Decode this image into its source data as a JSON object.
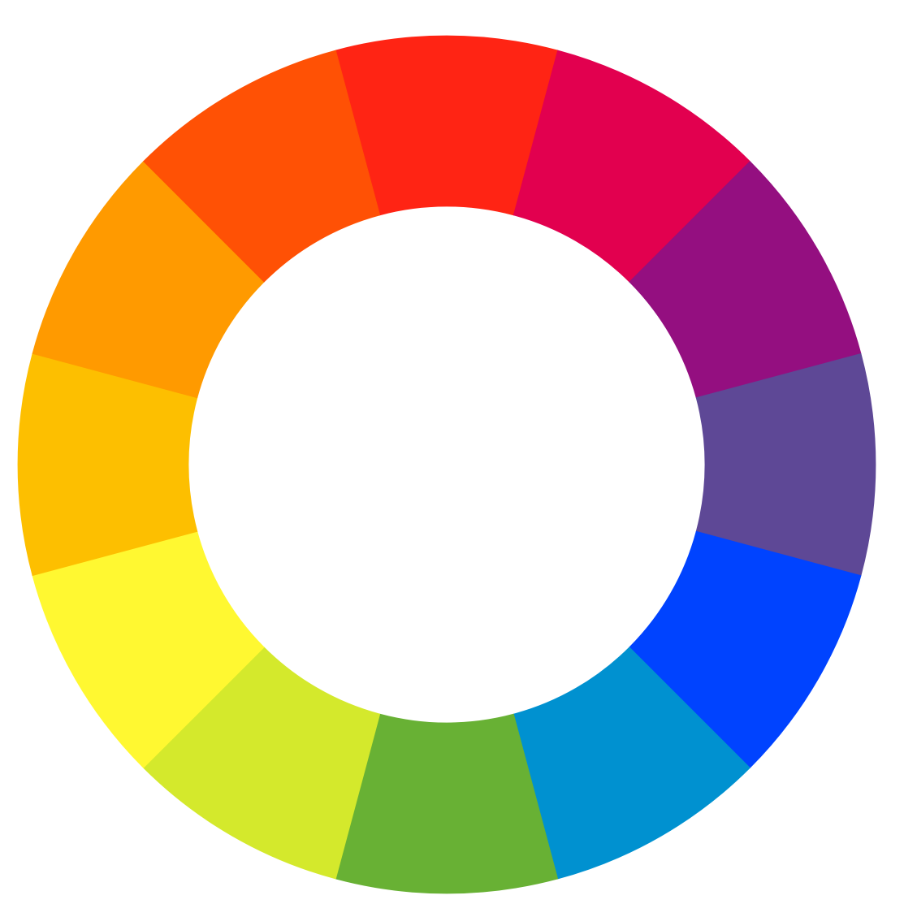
{
  "color_wheel": {
    "segment_count": 12,
    "background": "#ffffff",
    "segments": [
      {
        "name": "red",
        "color": "#ff2414"
      },
      {
        "name": "magenta",
        "color": "#e2004f"
      },
      {
        "name": "purple",
        "color": "#940f80"
      },
      {
        "name": "violet",
        "color": "#5e4896"
      },
      {
        "name": "blue",
        "color": "#0043ff"
      },
      {
        "name": "cyan-blue",
        "color": "#0091d0"
      },
      {
        "name": "green",
        "color": "#68b134"
      },
      {
        "name": "yellow-green",
        "color": "#d4e92c"
      },
      {
        "name": "yellow",
        "color": "#fff831"
      },
      {
        "name": "yellow-orange",
        "color": "#fdbf00"
      },
      {
        "name": "orange",
        "color": "#ff9a00"
      },
      {
        "name": "red-orange",
        "color": "#ff5105"
      }
    ]
  }
}
